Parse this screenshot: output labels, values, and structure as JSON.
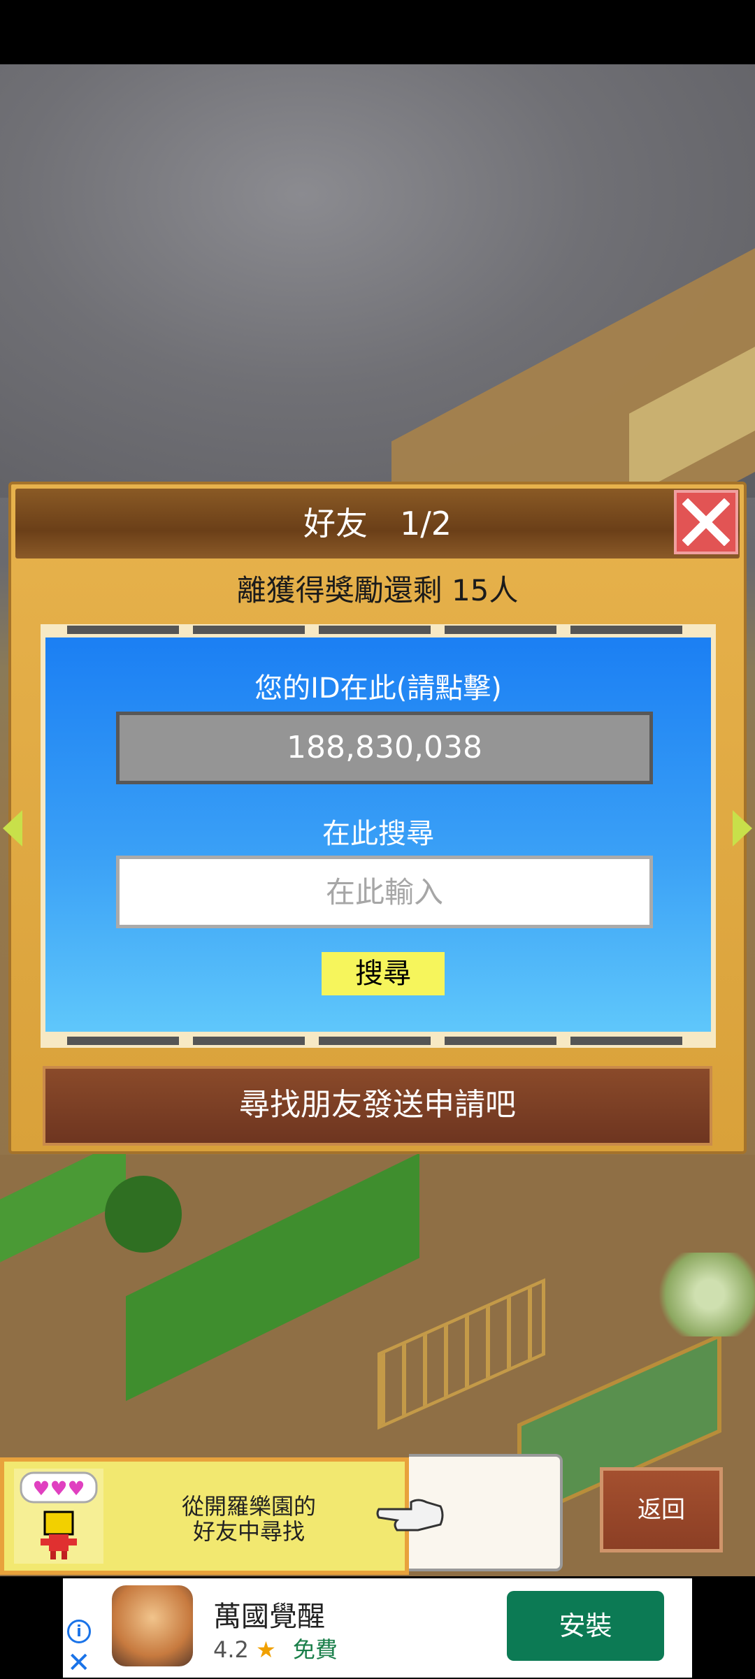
{
  "dialog": {
    "title": "好友　1/2",
    "reward_text": "離獲得獎勵還剩 15人",
    "id_label": "您的ID在此(請點擊)",
    "user_id": "188,830,038",
    "search_label": "在此搜尋",
    "search_placeholder": "在此輸入",
    "search_button": "搜尋",
    "send_request_button": "尋找朋友發送申請吧"
  },
  "bottom": {
    "find_text_line1": "從開羅樂園的",
    "find_text_line2": "好友中尋找",
    "back_button": "返回"
  },
  "ad": {
    "app_name": "萬國覺醒",
    "rating": "4.2",
    "star": "★",
    "price": "免費",
    "install_button": "安裝",
    "info_symbol": "i",
    "close_symbol": "✕"
  },
  "colors": {
    "panel_blue": "#1b7ff3",
    "dialog_gold": "#e7b24c",
    "close_red": "#e25454",
    "search_yellow": "#f6f55c",
    "install_green": "#0c7a54"
  }
}
